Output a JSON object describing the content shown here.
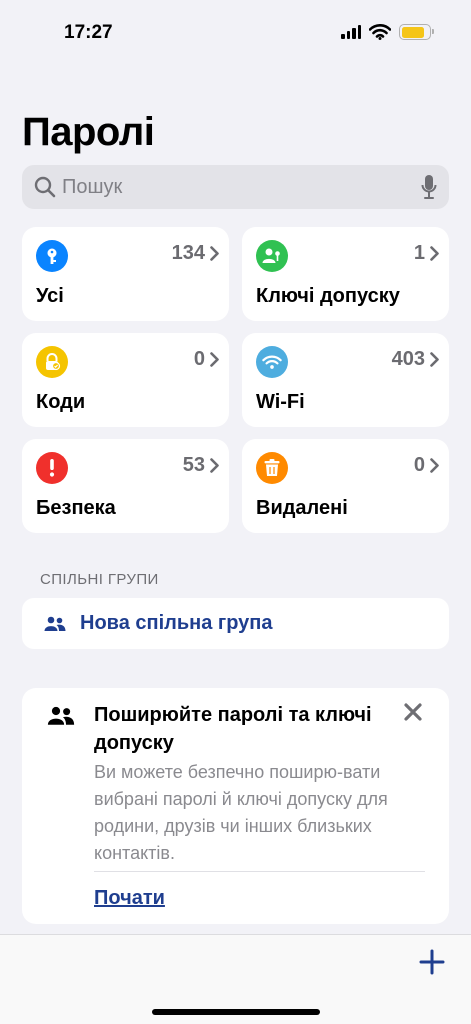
{
  "status_bar": {
    "time": "17:27",
    "battery_level": 0.85
  },
  "header": {
    "title": "Паролі"
  },
  "search": {
    "placeholder": "Пошук"
  },
  "tiles": [
    {
      "label": "Усі",
      "count": "134",
      "icon": "key-icon",
      "color": "#0a84ff"
    },
    {
      "label": "Ключі допуску",
      "count": "1",
      "icon": "passkey-person-icon",
      "color": "#30c152"
    },
    {
      "label": "Коди",
      "count": "0",
      "icon": "lock-check-icon",
      "color": "#f5c400"
    },
    {
      "label": "Wi-Fi",
      "count": "403",
      "icon": "wifi-icon",
      "color": "#4eaddf"
    },
    {
      "label": "Безпека",
      "count": "53",
      "icon": "exclamation-icon",
      "color": "#f0302c"
    },
    {
      "label": "Видалені",
      "count": "0",
      "icon": "trash-icon",
      "color": "#ff8a00"
    }
  ],
  "shared_groups": {
    "header": "СПІЛЬНІ ГРУПИ",
    "new_group_label": "Нова спільна група"
  },
  "promo_card": {
    "title": "Поширюйте паролі та ключі допуску",
    "body": "Ви можете безпечно поширю-вати вибрані паролі й ключі допуску для родини, друзів чи інших близьких контактів.",
    "action": "Почати"
  },
  "colors": {
    "accent": "#1f3e8f",
    "background": "#f2f2f7"
  }
}
